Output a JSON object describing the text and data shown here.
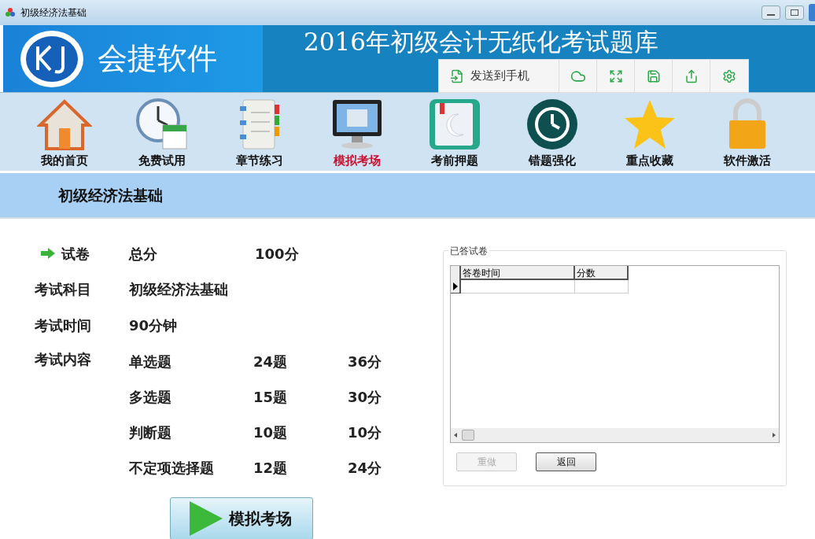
{
  "window": {
    "title": "初级经济法基础"
  },
  "banner": {
    "logo_text": "会捷软件",
    "title": "2016年初级会计无纸化考试题库"
  },
  "floating_toolbar": {
    "send_label": "发送到手机"
  },
  "nav": [
    {
      "label": "我的首页",
      "kind": "home",
      "selected": false
    },
    {
      "label": "免费试用",
      "kind": "clock",
      "selected": false
    },
    {
      "label": "章节练习",
      "kind": "notebook",
      "selected": false
    },
    {
      "label": "模拟考场",
      "kind": "monitor",
      "selected": true
    },
    {
      "label": "考前押题",
      "kind": "book",
      "selected": false
    },
    {
      "label": "错题强化",
      "kind": "history",
      "selected": false
    },
    {
      "label": "重点收藏",
      "kind": "star",
      "selected": false
    },
    {
      "label": "软件激活",
      "kind": "lock",
      "selected": false
    }
  ],
  "section": {
    "title": "初级经济法基础"
  },
  "exam": {
    "paper_label": "试卷",
    "total_label": "总分",
    "total_value": "100分",
    "subject_label": "考试科目",
    "subject_value": "初级经济法基础",
    "time_label": "考试时间",
    "time_value": "90分钟",
    "content_label": "考试内容",
    "content": [
      {
        "type": "单选题",
        "count": "24题",
        "score": "36分"
      },
      {
        "type": "多选题",
        "count": "15题",
        "score": "30分"
      },
      {
        "type": "判断题",
        "count": "10题",
        "score": "10分"
      },
      {
        "type": "不定项选择题",
        "count": "12题",
        "score": "24分"
      }
    ],
    "start_button": "模拟考场"
  },
  "answered": {
    "title": "已答试卷",
    "columns": [
      "答卷时间",
      "分数"
    ],
    "buttons": [
      {
        "label": "重做",
        "disabled": true
      },
      {
        "label": "返回",
        "disabled": false
      }
    ]
  }
}
